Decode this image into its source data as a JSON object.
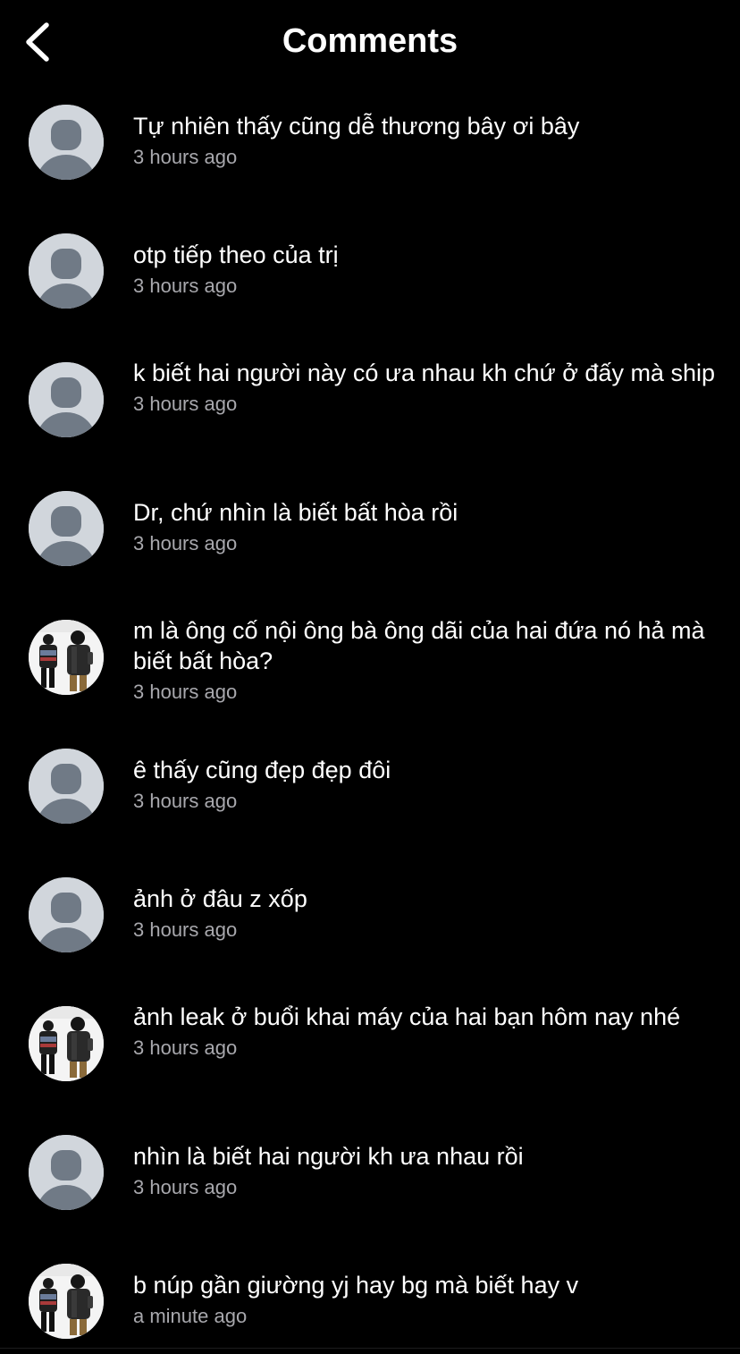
{
  "header": {
    "title": "Comments",
    "back_icon": "chevron-left-icon"
  },
  "comments": [
    {
      "text": "Tự nhiên thấy cũng dễ thương bây ơi bây",
      "time": "3 hours ago",
      "avatar": "default"
    },
    {
      "text": "otp tiếp theo của trị",
      "time": "3 hours ago",
      "avatar": "default"
    },
    {
      "text": "k biết hai người này có ưa nhau kh chứ ở đấy mà ship",
      "time": "3 hours ago",
      "avatar": "default"
    },
    {
      "text": "Dr, chứ nhìn là biết bất hòa rồi",
      "time": "3 hours ago",
      "avatar": "default"
    },
    {
      "text": "m là ông cố nội ông bà ông dãi của hai đứa nó hả mà biết bất hòa?",
      "time": "3 hours ago",
      "avatar": "photo"
    },
    {
      "text": "ê thấy cũng đẹp đẹp đôi",
      "time": "3 hours ago",
      "avatar": "default"
    },
    {
      "text": "ảnh ở đâu z xốp",
      "time": "3 hours ago",
      "avatar": "default"
    },
    {
      "text": "ảnh leak ở buổi khai máy của hai bạn hôm nay nhé",
      "time": "3 hours ago",
      "avatar": "photo"
    },
    {
      "text": "nhìn là biết hai người kh ưa nhau rồi",
      "time": "3 hours ago",
      "avatar": "default"
    },
    {
      "text": "b núp gần giường yj hay bg mà biết hay v",
      "time": "a minute ago",
      "avatar": "photo"
    }
  ],
  "colors": {
    "background": "#000000",
    "text": "#ffffff",
    "timestamp": "#a8a8ad",
    "default_avatar_bg": "#d1d6dc",
    "default_avatar_figure": "#707a86"
  }
}
